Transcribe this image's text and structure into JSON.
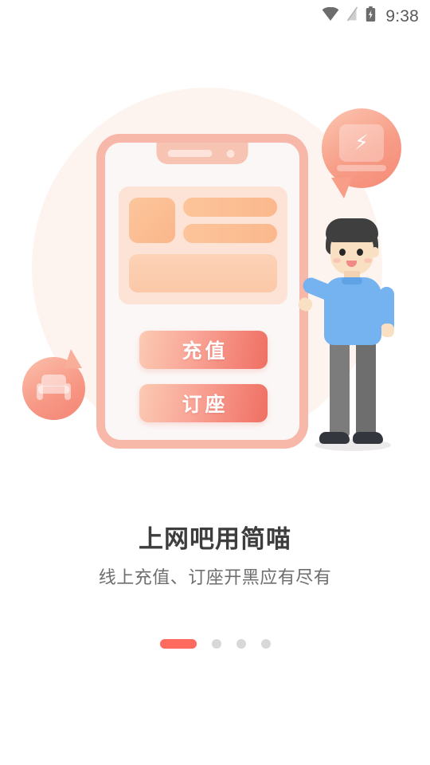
{
  "statusbar": {
    "time": "9:38",
    "icons": [
      {
        "name": "wifi-icon",
        "label": "wifi"
      },
      {
        "name": "signal-off-icon",
        "label": "no signal"
      },
      {
        "name": "battery-charging-icon",
        "label": "battery charging"
      }
    ]
  },
  "illustration": {
    "name": "onboarding-illustration",
    "phone": {
      "buttons": [
        {
          "name": "recharge-button",
          "label": "充值"
        },
        {
          "name": "reserve-button",
          "label": "订座"
        }
      ]
    },
    "bubbles": [
      {
        "name": "computer-bubble",
        "icon": "monitor-lightning-icon",
        "glyph": "⚡"
      },
      {
        "name": "seat-bubble",
        "icon": "armchair-icon"
      }
    ],
    "character": {
      "name": "standing-person"
    }
  },
  "content": {
    "title": "上网吧用简喵",
    "subtitle": "线上充值、订座开黑应有尽有"
  },
  "pagination": {
    "total": 4,
    "active_index": 0,
    "dots": [
      "1",
      "2",
      "3",
      "4"
    ]
  },
  "colors": {
    "accent": "#fd6b5e",
    "title": "#3d3d3d",
    "subtitle": "#6e6e6e",
    "phone_frame": "#f7b7a9",
    "blob": "#fdf1ec",
    "sweater": "#74b2f0",
    "dot_inactive": "#d8d8d8"
  }
}
